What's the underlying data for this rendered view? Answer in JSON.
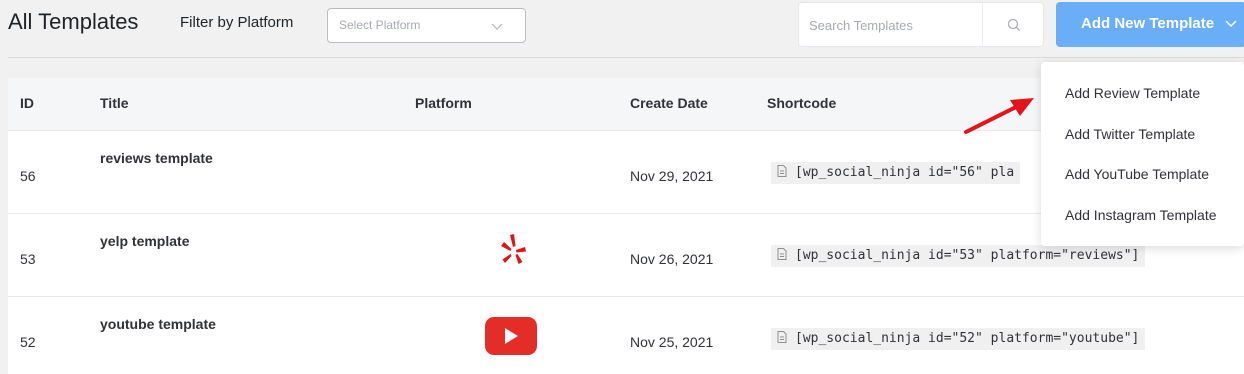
{
  "header": {
    "title": "All Templates",
    "filter_label": "Filter by Platform",
    "filter_placeholder": "Select Platform",
    "search_placeholder": "Search Templates",
    "add_button_label": "Add New Template"
  },
  "table": {
    "columns": [
      "ID",
      "Title",
      "Platform",
      "Create Date",
      "Shortcode"
    ],
    "rows": [
      {
        "id": "56",
        "title": "reviews template",
        "platform_icon": "",
        "date": "Nov 29, 2021",
        "shortcode": "[wp_social_ninja id=\"56\" pla"
      },
      {
        "id": "53",
        "title": "yelp template",
        "platform_icon": "yelp-icon",
        "date": "Nov 26, 2021",
        "shortcode": "[wp_social_ninja id=\"53\" platform=\"reviews\"]"
      },
      {
        "id": "52",
        "title": "youtube template",
        "platform_icon": "youtube-icon",
        "date": "Nov 25, 2021",
        "shortcode": "[wp_social_ninja id=\"52\" platform=\"youtube\"]"
      }
    ]
  },
  "dropdown": {
    "items": [
      "Add Review Template",
      "Add Twitter Template",
      "Add YouTube Template",
      "Add Instagram Template"
    ]
  },
  "colors": {
    "accent": "#6aaef7",
    "arrow": "#e3141b",
    "yelp": "#e0151b",
    "youtube": "#e52d27"
  },
  "icons": [
    "chevron-down-icon",
    "search-icon",
    "document-icon",
    "yelp-icon",
    "youtube-icon",
    "annotation-arrow"
  ]
}
